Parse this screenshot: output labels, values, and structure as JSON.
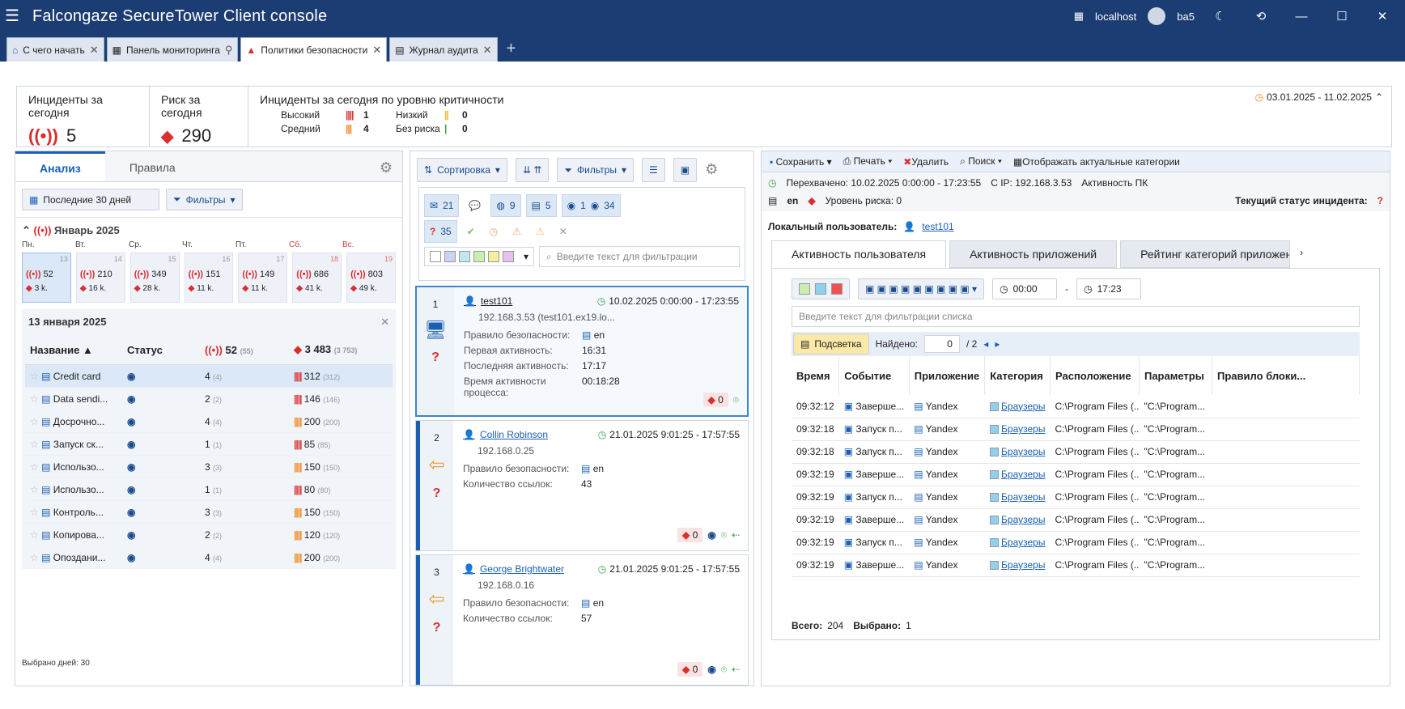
{
  "titlebar": {
    "title_prefix": "Falcongaze SecureTower",
    "title_suffix": "Client console",
    "host": "localhost",
    "user": "ba5"
  },
  "tabs": [
    {
      "label": "С чего начать"
    },
    {
      "label": "Панель мониторинга"
    },
    {
      "label": "Политики безопасности"
    },
    {
      "label": "Журнал аудита"
    }
  ],
  "summary": {
    "incidents_title": "Инциденты за сегодня",
    "incidents_value": "5",
    "risk_title": "Риск за сегодня",
    "risk_value": "290",
    "crit_title": "Инциденты за сегодня по уровню критичности",
    "high_label": "Высокий",
    "high_value": "1",
    "medium_label": "Средний",
    "medium_value": "4",
    "low_label": "Низкий",
    "low_value": "0",
    "norisk_label": "Без риска",
    "norisk_value": "0",
    "daterange": "03.01.2025 - 11.02.2025"
  },
  "left": {
    "tab_analysis": "Анализ",
    "tab_rules": "Правила",
    "period": "Последние 30 дней",
    "filters": "Фильтры",
    "month": "Январь 2025",
    "weekdays": [
      "Пн.",
      "Вт.",
      "Ср.",
      "Чт.",
      "Пт.",
      "Сб.",
      "Вс."
    ],
    "days": [
      {
        "n": "13",
        "a": "52",
        "b": "3 k."
      },
      {
        "n": "14",
        "a": "210",
        "b": "16 k."
      },
      {
        "n": "15",
        "a": "349",
        "b": "28 k."
      },
      {
        "n": "16",
        "a": "151",
        "b": "11 k."
      },
      {
        "n": "17",
        "a": "149",
        "b": "11 k."
      },
      {
        "n": "18",
        "a": "686",
        "b": "41 k."
      },
      {
        "n": "19",
        "a": "803",
        "b": "49 k."
      }
    ],
    "day_title": "13 января 2025",
    "col_name": "Название",
    "col_status": "Статус",
    "col_inc": "52",
    "col_inc_sub": "(55)",
    "col_risk": "3 483",
    "col_risk_sub": "(3 753)",
    "rows": [
      {
        "name": "Credit card",
        "inc": "4",
        "incs": "(4)",
        "risk": "312",
        "risks": "(312)"
      },
      {
        "name": "Data sendi...",
        "inc": "2",
        "incs": "(2)",
        "risk": "146",
        "risks": "(146)"
      },
      {
        "name": "Досрочно...",
        "inc": "4",
        "incs": "(4)",
        "risk": "200",
        "risks": "(200)"
      },
      {
        "name": "Запуск ск...",
        "inc": "1",
        "incs": "(1)",
        "risk": "85",
        "risks": "(85)"
      },
      {
        "name": "Использо...",
        "inc": "3",
        "incs": "(3)",
        "risk": "150",
        "risks": "(150)"
      },
      {
        "name": "Использо...",
        "inc": "1",
        "incs": "(1)",
        "risk": "80",
        "risks": "(80)"
      },
      {
        "name": "Контроль...",
        "inc": "3",
        "incs": "(3)",
        "risk": "150",
        "risks": "(150)"
      },
      {
        "name": "Копирова...",
        "inc": "2",
        "incs": "(2)",
        "risk": "120",
        "risks": "(120)"
      },
      {
        "name": "Опоздани...",
        "inc": "4",
        "incs": "(4)",
        "risk": "200",
        "risks": "(200)"
      }
    ],
    "selected_days": "Выбрано дней: 30"
  },
  "middle": {
    "sort": "Сортировка",
    "filters": "Фильтры",
    "f_mail": "21",
    "f_web": "9",
    "f_dev": "5",
    "f_view1": "1",
    "f_view2": "34",
    "f_q": "35",
    "search_placeholder": "Введите текст для фильтрации",
    "incidents": [
      {
        "num": "1",
        "user": "test101",
        "ip": "192.168.3.53 (test101.ex19.lo...",
        "date": "10.02.2025 0:00:00 - 17:23:55",
        "k1": "Правило безопасности:",
        "v1": "en",
        "k2": "Первая активность:",
        "v2": "16:31",
        "k3": "Последняя активность:",
        "v3": "17:17",
        "k4": "Время активности процесса:",
        "v4": "00:18:28",
        "risk": "0"
      },
      {
        "num": "2",
        "user": "Collin Robinson",
        "ip": "192.168.0.25",
        "date": "21.01.2025 9:01:25 - 17:57:55",
        "k1": "Правило безопасности:",
        "v1": "en",
        "k2": "Количество ссылок:",
        "v2": "43",
        "risk": "0"
      },
      {
        "num": "3",
        "user": "George Brightwater",
        "ip": "192.168.0.16",
        "date": "21.01.2025 9:01:25 - 17:57:55",
        "k1": "Правило безопасности:",
        "v1": "en",
        "k2": "Количество ссылок:",
        "v2": "57",
        "risk": "0"
      }
    ]
  },
  "right": {
    "save": "Сохранить",
    "print": "Печать",
    "delete": "Удалить",
    "search": "Поиск",
    "show_cats": "Отображать актуальные категории",
    "intercepted": "Перехвачено: 10.02.2025 0:00:00 - 17:23:55",
    "cip": "С IP:  192.168.3.53",
    "activity": "Активность ПК",
    "lang": "en",
    "risk_level": "Уровень риска: 0",
    "status_label": "Текущий статус инцидента:",
    "local_user_label": "Локальный пользователь:",
    "local_user": "test101",
    "subtabs": [
      "Активность пользователя",
      "Активность приложений",
      "Рейтинг категорий приложени"
    ],
    "time_from": "00:00",
    "time_to": "17:23",
    "list_filter_placeholder": "Введите текст для фильтрации списка",
    "highlight": "Подсветка",
    "found_label": "Найдено:",
    "found_value": "0",
    "found_total": "/ 2",
    "cols": [
      "Время",
      "Событие",
      "Приложение",
      "Категория",
      "Расположение",
      "Параметры",
      "Правило блоки..."
    ],
    "events": [
      {
        "t": "09:32:12",
        "e": "Заверше...",
        "a": "Yandex",
        "c": "Браузеры",
        "l": "C:\\Program Files (...",
        "p": "\"C:\\Program..."
      },
      {
        "t": "09:32:18",
        "e": "Запуск п...",
        "a": "Yandex",
        "c": "Браузеры",
        "l": "C:\\Program Files (...",
        "p": "\"C:\\Program..."
      },
      {
        "t": "09:32:18",
        "e": "Запуск п...",
        "a": "Yandex",
        "c": "Браузеры",
        "l": "C:\\Program Files (...",
        "p": "\"C:\\Program..."
      },
      {
        "t": "09:32:19",
        "e": "Заверше...",
        "a": "Yandex",
        "c": "Браузеры",
        "l": "C:\\Program Files (...",
        "p": "\"C:\\Program..."
      },
      {
        "t": "09:32:19",
        "e": "Запуск п...",
        "a": "Yandex",
        "c": "Браузеры",
        "l": "C:\\Program Files (...",
        "p": "\"C:\\Program..."
      },
      {
        "t": "09:32:19",
        "e": "Заверше...",
        "a": "Yandex",
        "c": "Браузеры",
        "l": "C:\\Program Files (...",
        "p": "\"C:\\Program..."
      },
      {
        "t": "09:32:19",
        "e": "Запуск п...",
        "a": "Yandex",
        "c": "Браузеры",
        "l": "C:\\Program Files (...",
        "p": "\"C:\\Program..."
      },
      {
        "t": "09:32:19",
        "e": "Заверше...",
        "a": "Yandex",
        "c": "Браузеры",
        "l": "C:\\Program Files (...",
        "p": "\"C:\\Program..."
      }
    ],
    "total_label": "Всего:",
    "total": "204",
    "selected_label": "Выбрано:",
    "selected": "1"
  }
}
